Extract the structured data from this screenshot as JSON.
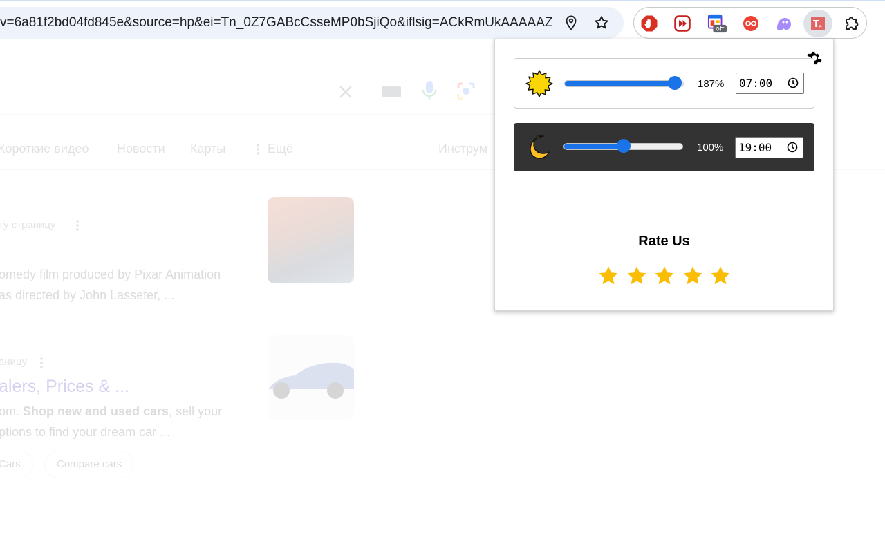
{
  "browser": {
    "url": "v=6a81f2bd04fd845e&source=hp&ei=Tn_0Z7GABcCsseMP0bSjiQo&iflsig=ACkRmUkAAAAAZ...",
    "extensions": [
      {
        "name": "stop-hand-extension",
        "color": "#d93025"
      },
      {
        "name": "skip-forward-extension",
        "color": "#c5221f"
      },
      {
        "name": "layout-off-extension",
        "color": "#8430ce",
        "badge": "off"
      },
      {
        "name": "infinity-extension",
        "color": "#ea4335"
      },
      {
        "name": "ghost-extension",
        "color": "#a78bfa"
      },
      {
        "name": "text-tool-extension",
        "color": "#e06666"
      },
      {
        "name": "puzzle-extensions-menu",
        "color": "#202124"
      }
    ]
  },
  "background": {
    "tabs": [
      "Короткие видео",
      "Новости",
      "Карты",
      "Ещё",
      "Инструм"
    ],
    "result1": {
      "source": "ту страницу",
      "snippet_line1": "omedy film produced by Pixar Animation",
      "snippet_line2": "as directed by John Lasseter, ..."
    },
    "result2": {
      "source": "аницу",
      "title": "alers, Prices & ...",
      "snippet_line1_prefix": "om. ",
      "snippet_line1_bold": "Shop new and used cars",
      "snippet_line1_suffix": ", sell your",
      "snippet_line2": "ptions to find your dream car ...",
      "chips": [
        "Cars",
        "Compare cars"
      ]
    }
  },
  "popup": {
    "day": {
      "icon": "sun-icon",
      "brightness_label": "187%",
      "brightness_fraction": 0.93,
      "time": "07:00"
    },
    "night": {
      "icon": "moon-icon",
      "brightness_label": "100%",
      "brightness_fraction": 0.5,
      "time": "19:00"
    },
    "rate_title": "Rate Us",
    "stars_count": 5,
    "colors": {
      "accent": "#1a73e8",
      "night_bg": "#333333",
      "star": "#fbbc04"
    }
  }
}
